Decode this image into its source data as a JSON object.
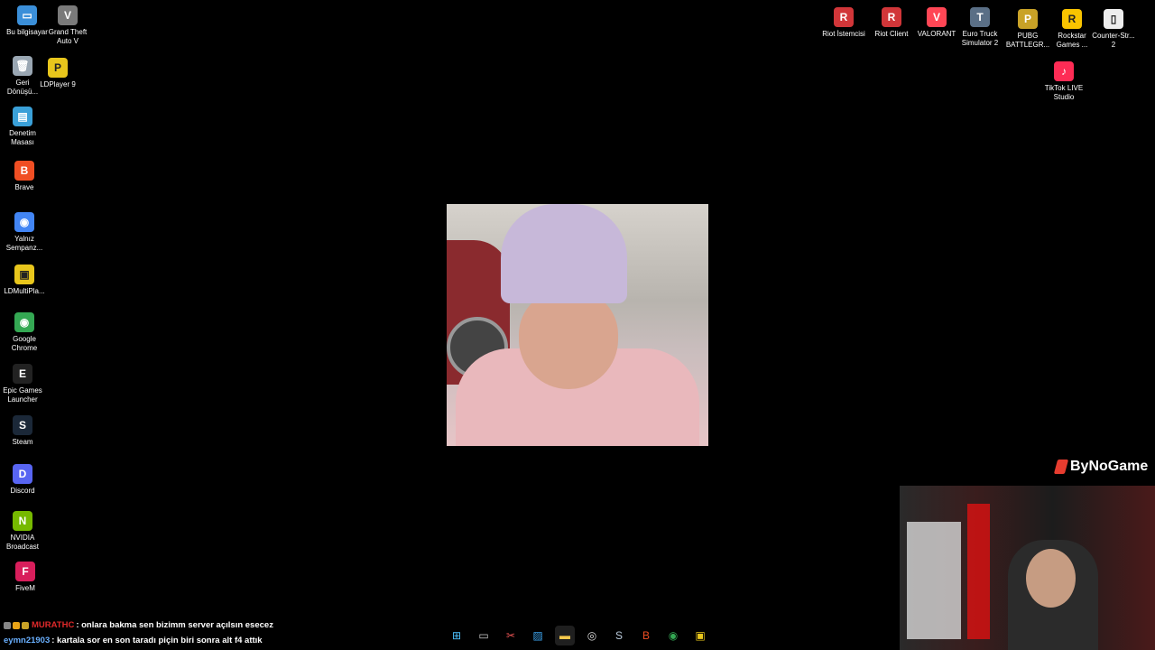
{
  "desktop_left": [
    {
      "label": "Bu bilgisayar",
      "icon": "computer-icon",
      "color": "#3b8fd9",
      "glyph": "▭"
    },
    {
      "label": "Grand Theft\nAuto V",
      "icon": "gta-icon",
      "color": "#7a7a7a",
      "glyph": "V"
    },
    {
      "label": "Geri\nDönüşü...",
      "icon": "recycle-bin-icon",
      "color": "#9aa7b3",
      "glyph": "🗑"
    },
    {
      "label": "LDPlayer 9",
      "icon": "ldplayer-icon",
      "color": "#e8c61c",
      "glyph": "P"
    },
    {
      "label": "Denetim\nMasası",
      "icon": "control-panel-icon",
      "color": "#3aa0d8",
      "glyph": "▤"
    },
    {
      "label": "Brave",
      "icon": "brave-icon",
      "color": "#f04e23",
      "glyph": "B"
    },
    {
      "label": "Yalnız\nSempanz...",
      "icon": "chrome-profile-icon",
      "color": "#4285f4",
      "glyph": "◉"
    },
    {
      "label": "LDMultiPla...",
      "icon": "ldmultiplayer-icon",
      "color": "#e8c61c",
      "glyph": "▣"
    },
    {
      "label": "Google\nChrome",
      "icon": "chrome-icon",
      "color": "#34a853",
      "glyph": "◉"
    },
    {
      "label": "Epic Games\nLauncher",
      "icon": "epic-games-icon",
      "color": "#222222",
      "glyph": "E"
    },
    {
      "label": "Steam",
      "icon": "steam-icon",
      "color": "#1b2838",
      "glyph": "S"
    },
    {
      "label": "Discord",
      "icon": "discord-icon",
      "color": "#5865f2",
      "glyph": "D"
    },
    {
      "label": "NVIDIA\nBroadcast",
      "icon": "nvidia-icon",
      "color": "#76b900",
      "glyph": "N"
    },
    {
      "label": "FiveM",
      "icon": "fivem-icon",
      "color": "#d81e5b",
      "glyph": "F"
    }
  ],
  "desktop_right": [
    {
      "label": "Riot İstemcisi",
      "icon": "riot-client-icon",
      "color": "#d13639",
      "glyph": "R"
    },
    {
      "label": "Riot Client",
      "icon": "riot-client-icon",
      "color": "#d13639",
      "glyph": "R"
    },
    {
      "label": "VALORANT",
      "icon": "valorant-icon",
      "color": "#ff4655",
      "glyph": "V"
    },
    {
      "label": "Euro Truck\nSimulator 2",
      "icon": "euro-truck-icon",
      "color": "#5a6f86",
      "glyph": "T"
    },
    {
      "label": "PUBG\nBATTLEGR...",
      "icon": "pubg-icon",
      "color": "#c9a227",
      "glyph": "P"
    },
    {
      "label": "Rockstar\nGames ...",
      "icon": "rockstar-icon",
      "color": "#f9c400",
      "glyph": "R"
    },
    {
      "label": "Counter-Str...\n2",
      "icon": "file-icon",
      "color": "#eeeeee",
      "glyph": "▯"
    },
    {
      "label": "TikTok LIVE\nStudio",
      "icon": "tiktok-live-icon",
      "color": "#fe2c55",
      "glyph": "♪"
    }
  ],
  "brand": {
    "text": "ByNoGame"
  },
  "chat": [
    {
      "user": "MURATHC",
      "user_color": "#e0292a",
      "message": ": onlara bakma sen bizimm server açılsın esecez"
    },
    {
      "user": "eymn21903",
      "user_color": "#6ab0ff",
      "message": ": kartala sor en son taradı piçin biri sonra alt f4 attık"
    }
  ],
  "taskbar": [
    {
      "icon": "windows-start-icon",
      "glyph": "⊞",
      "color": "#4cc2ff"
    },
    {
      "icon": "task-view-icon",
      "glyph": "▭",
      "color": "#cccccc"
    },
    {
      "icon": "snipping-tool-icon",
      "glyph": "✂",
      "color": "#e55"
    },
    {
      "icon": "photos-icon",
      "glyph": "▨",
      "color": "#3ba0e8"
    },
    {
      "icon": "file-explorer-icon",
      "glyph": "▬",
      "color": "#f8c94c",
      "active": true
    },
    {
      "icon": "obs-icon",
      "glyph": "◎",
      "color": "#dddddd"
    },
    {
      "icon": "steam-icon",
      "glyph": "S",
      "color": "#bcd"
    },
    {
      "icon": "brave-icon",
      "glyph": "B",
      "color": "#f04e23"
    },
    {
      "icon": "chrome-icon",
      "glyph": "◉",
      "color": "#34a853"
    },
    {
      "icon": "app-icon",
      "glyph": "▣",
      "color": "#e8c61c"
    }
  ]
}
